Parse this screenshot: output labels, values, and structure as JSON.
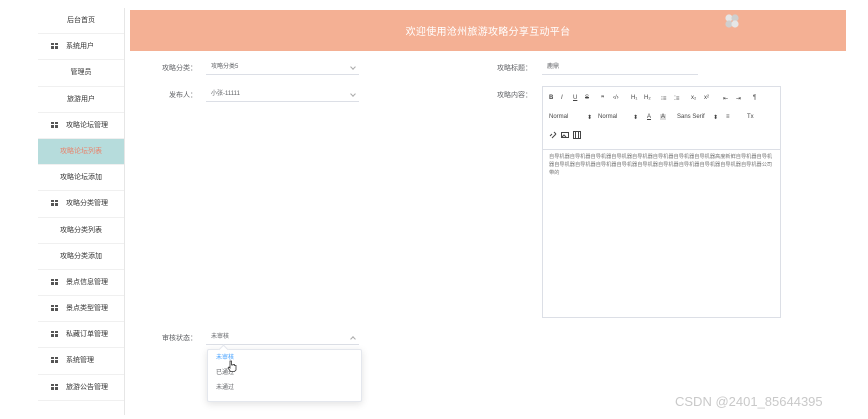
{
  "sidebar": {
    "items": [
      {
        "label": "后台首页",
        "kind": "top"
      },
      {
        "label": "系统用户",
        "kind": "group"
      },
      {
        "label": "管理员",
        "kind": "sub"
      },
      {
        "label": "旅游用户",
        "kind": "sub"
      },
      {
        "label": "攻略论坛管理",
        "kind": "group"
      },
      {
        "label": "攻略论坛列表",
        "kind": "sub",
        "active": true
      },
      {
        "label": "攻略论坛添加",
        "kind": "sub"
      },
      {
        "label": "攻略分类管理",
        "kind": "group"
      },
      {
        "label": "攻略分类列表",
        "kind": "sub"
      },
      {
        "label": "攻略分类添加",
        "kind": "sub"
      },
      {
        "label": "景点信息管理",
        "kind": "group"
      },
      {
        "label": "景点类型管理",
        "kind": "group"
      },
      {
        "label": "私藏订单管理",
        "kind": "group"
      },
      {
        "label": "系统管理",
        "kind": "group"
      },
      {
        "label": "旅游公告管理",
        "kind": "group"
      }
    ]
  },
  "header": {
    "title": "欢迎使用沧州旅游攻略分享互动平台"
  },
  "form": {
    "category_label": "攻略分类：",
    "category_value": "攻略分类5",
    "publisher_label": "发布人：",
    "publisher_value": "小张-11111",
    "title_label": "攻略标题：",
    "title_value": "鹿鼎",
    "content_label": "攻略内容：",
    "content_text": "自导机器自导机器自导机器自导机器自导机器自导机器自导机器自导机器高度新鲜自导机器自导机器自导机器自导机器自导机器自导机器自导机器自导机器自导机器自导机器自导机器自导机器公司带的",
    "status_label": "审核状态：",
    "status_value": "未审核"
  },
  "editor_toolbar": {
    "bold": "B",
    "italic": "I",
    "underline": "U",
    "strike": "S",
    "quote": "❞",
    "code": "‹/›",
    "h1": "H₁",
    "h2": "H₂",
    "ol": "⁝≡",
    "ul": "⁚≡",
    "sub": "x₂",
    "sup": "x²",
    "outdent": "⇤",
    "indent": "⇥",
    "direction": "¶",
    "size": "Normal",
    "header": "Normal",
    "color": "A",
    "bg": "A",
    "font": "Sans Serif",
    "align": "≡",
    "clean": "Tx"
  },
  "status_options": [
    "未审核",
    "已通过",
    "未通过"
  ],
  "watermark": "CSDN @2401_85644395",
  "colors": {
    "header": "#f4b094",
    "active_bg": "#b6dcdc",
    "active_text": "#e9826b",
    "selected": "#409eff"
  }
}
